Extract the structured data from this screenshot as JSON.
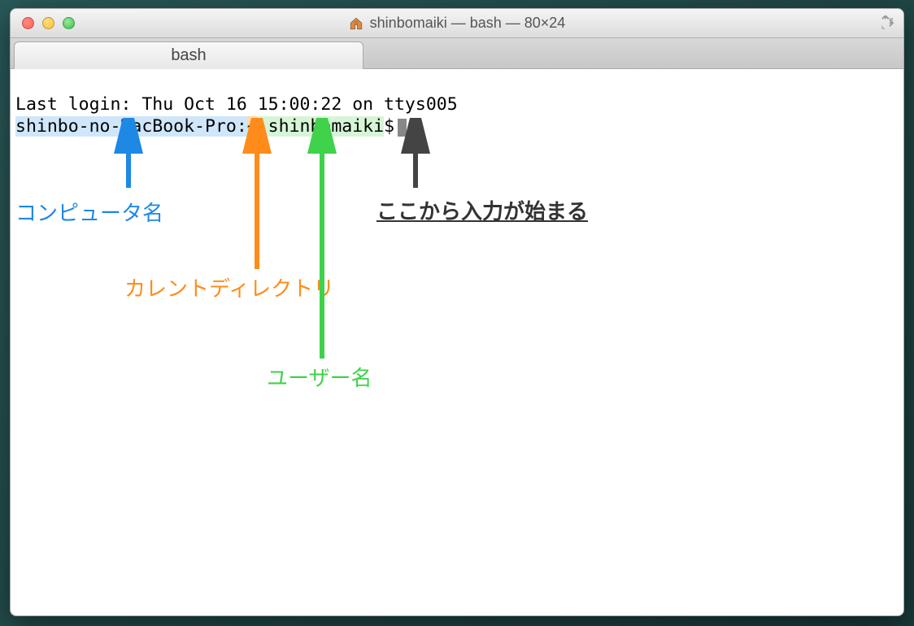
{
  "window": {
    "title": "shinbomaiki — bash — 80×24"
  },
  "tab": {
    "label": "bash"
  },
  "terminal": {
    "last_login": "Last login: Thu Oct 16 15:00:22 on ttys005",
    "prompt": {
      "computer": "shinbo-no-MacBook-Pro:",
      "dir": "~",
      "user": " shinbomaiki",
      "symbol": "$"
    }
  },
  "annotations": {
    "computer_label": "コンピュータ名",
    "dir_label": "カレントディレクトリ",
    "user_label": "ユーザー名",
    "input_label": "ここから入力が始まる"
  }
}
